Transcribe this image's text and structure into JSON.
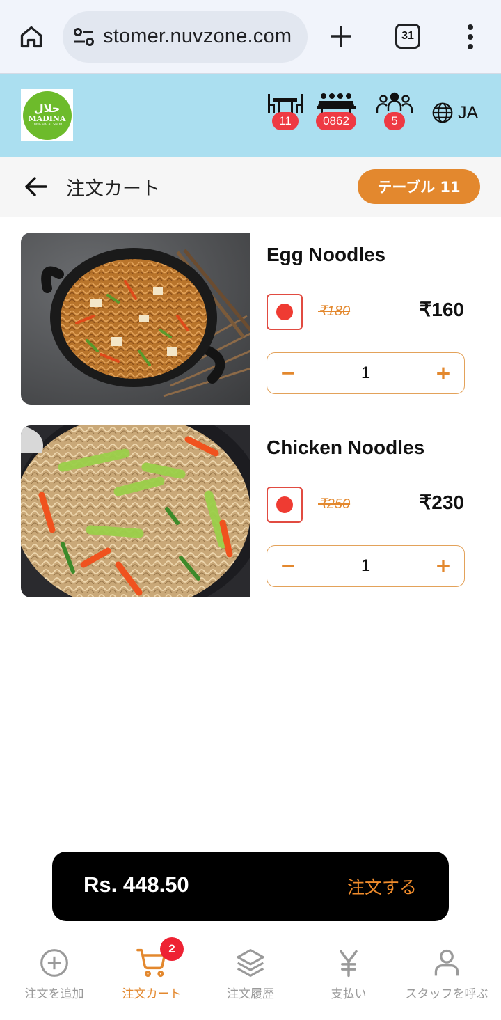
{
  "browser": {
    "url": "stomer.nuvzone.com",
    "tab_count": "31"
  },
  "header": {
    "logo": {
      "arabic": "حلال",
      "name": "MADINA",
      "tagline": "100% HALAL SHOP"
    },
    "table_badge": "11",
    "order_badge": "0862",
    "guests_badge": "5",
    "language": "JA"
  },
  "page": {
    "title": "注文カート",
    "table_label": "テーブル 11"
  },
  "items": [
    {
      "name": "Egg Noodles",
      "old_price": "₹180",
      "price": "₹160",
      "quantity": "1",
      "minus": "−",
      "plus": "+"
    },
    {
      "name": "Chicken Noodles",
      "old_price": "₹250",
      "price": "₹230",
      "quantity": "1",
      "minus": "−",
      "plus": "+"
    }
  ],
  "checkout": {
    "total": "Rs. 448.50",
    "order_label": "注文する"
  },
  "nav": {
    "items": [
      {
        "label": "注文を追加",
        "icon": "plus-circle-icon"
      },
      {
        "label": "注文カート",
        "icon": "cart-icon",
        "active": true
      },
      {
        "label": "注文履歴",
        "icon": "layers-icon"
      },
      {
        "label": "支払い",
        "icon": "yen-icon"
      },
      {
        "label": "スタッフを呼ぶ",
        "icon": "person-icon"
      }
    ],
    "cart_badge": "2"
  },
  "colors": {
    "accent": "#e3882e",
    "header_bg": "#abdff0",
    "badge_red": "#ee3a43",
    "veg_red": "#ef3b32"
  }
}
